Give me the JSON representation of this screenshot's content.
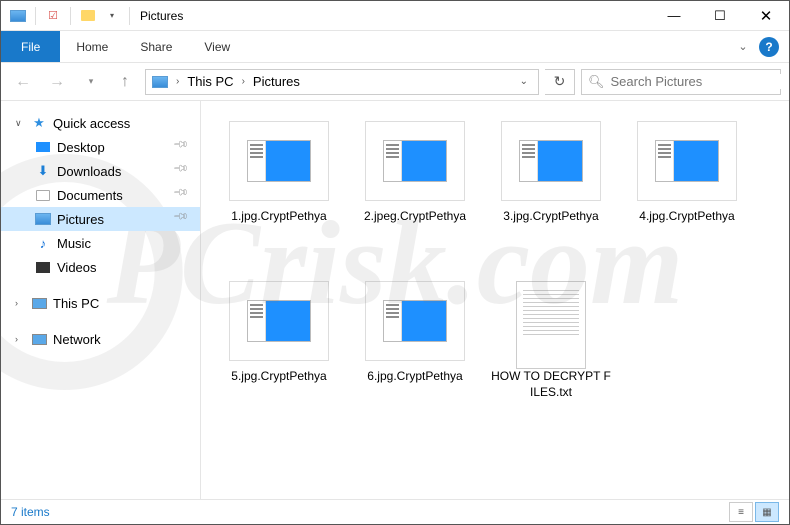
{
  "window": {
    "title": "Pictures"
  },
  "ribbon": {
    "file": "File",
    "home": "Home",
    "share": "Share",
    "view": "View"
  },
  "address": {
    "crumbs": [
      "This PC",
      "Pictures"
    ]
  },
  "search": {
    "placeholder": "Search Pictures"
  },
  "sidebar": {
    "quick_access": "Quick access",
    "items": [
      {
        "label": "Desktop"
      },
      {
        "label": "Downloads"
      },
      {
        "label": "Documents"
      },
      {
        "label": "Pictures"
      },
      {
        "label": "Music"
      },
      {
        "label": "Videos"
      }
    ],
    "this_pc": "This PC",
    "network": "Network"
  },
  "files": [
    {
      "name": "1.jpg.CryptPethya",
      "type": "img"
    },
    {
      "name": "2.jpeg.CryptPethya",
      "type": "img"
    },
    {
      "name": "3.jpg.CryptPethya",
      "type": "img"
    },
    {
      "name": "4.jpg.CryptPethya",
      "type": "img"
    },
    {
      "name": "5.jpg.CryptPethya",
      "type": "img"
    },
    {
      "name": "6.jpg.CryptPethya",
      "type": "img"
    },
    {
      "name": "HOW TO DECRYPT FILES.txt",
      "type": "txt"
    }
  ],
  "status": {
    "count": "7 items"
  }
}
